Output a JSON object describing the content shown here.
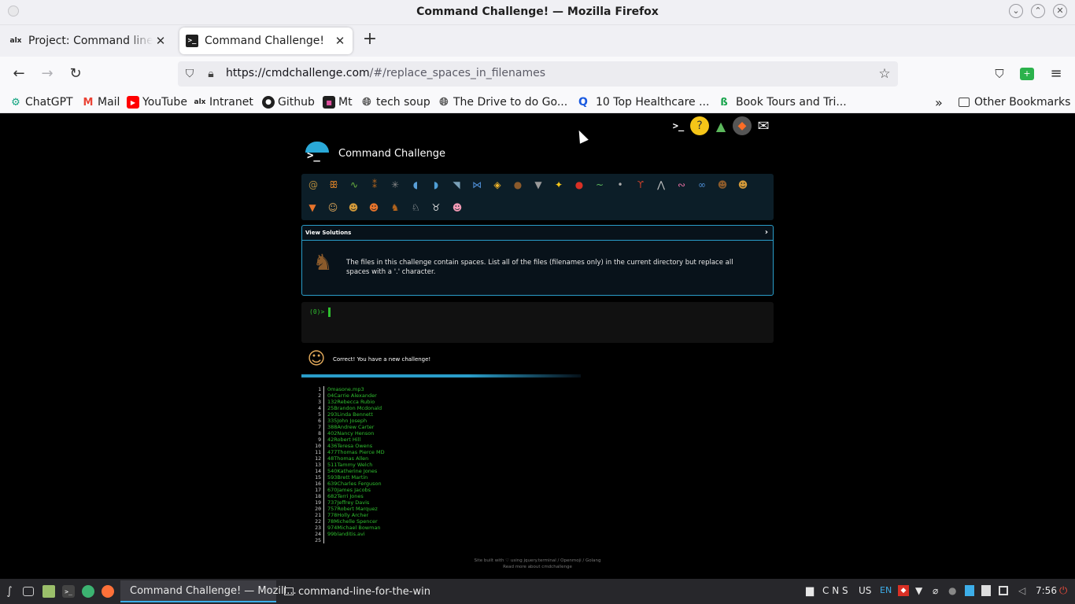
{
  "window": {
    "title": "Command Challenge! — Mozilla Firefox"
  },
  "tabs": [
    {
      "label": "Project: Command line fo",
      "favicon": "alx-icon",
      "active": false
    },
    {
      "label": "Command Challenge!",
      "favicon": "terminal-icon",
      "active": true
    }
  ],
  "nav": {
    "url_host": "https://cmdchallenge.com",
    "url_path": "/#/replace_spaces_in_filenames"
  },
  "bookmarks": [
    {
      "label": "ChatGPT",
      "icon": "chatgpt-icon",
      "color": "#10a37f"
    },
    {
      "label": "Mail",
      "icon": "gmail-icon",
      "color": "#ea4335"
    },
    {
      "label": "YouTube",
      "icon": "youtube-icon",
      "color": "#ff0000"
    },
    {
      "label": "Intranet",
      "icon": "alx-icon",
      "color": "#1f1f1f"
    },
    {
      "label": "Github",
      "icon": "github-icon",
      "color": "#1f1f1f"
    },
    {
      "label": "Mt",
      "icon": "mt-icon",
      "color": "#7b3fa0"
    },
    {
      "label": "tech soup",
      "icon": "globe-icon",
      "color": "#555555"
    },
    {
      "label": "The Drive to do Go...",
      "icon": "globe-icon",
      "color": "#555555"
    },
    {
      "label": "10 Top Healthcare ...",
      "icon": "healthcare-icon",
      "color": "#1a5ae0"
    },
    {
      "label": "Book Tours and Tri...",
      "icon": "tours-icon",
      "color": "#16a34a"
    }
  ],
  "other_bookmarks": "Other Bookmarks",
  "page": {
    "brand": "Command Challenge",
    "view_solutions": "View Solutions",
    "challenge_text": "The files in this challenge contain spaces. List all of the files (filenames only) in the current directory but replace all spaces with a '.' character.",
    "prompt": "(0)>",
    "result_message": "Correct! You have a new challenge!",
    "footer_line1": "Site built with ♡ using jquery.terminal / Openmoji / Golang",
    "footer_line2": "Read more about cmdchallenge"
  },
  "animals": [
    "snail",
    "butterfly",
    "caterpillar",
    "ant",
    "spider",
    "whale",
    "dolphin",
    "shark",
    "fish",
    "tropical-fish",
    "hedgehog",
    "wolf",
    "bee",
    "ladybug",
    "lizard",
    "mosquito",
    "scorpion",
    "fly",
    "worm",
    "link",
    "monkey",
    "dog",
    "fox",
    "lion",
    "tiger",
    "tiger-face",
    "horse",
    "unicorn",
    "cow",
    "pig"
  ],
  "output_files": [
    "0masone.mp3",
    "04Carrie Alexander",
    "132Rebecca Rubio",
    "25Brandon Mcdonald",
    "293Linda Bennett",
    "335John Joseph",
    "388Andrew Carter",
    "402Nancy Henson",
    "42Robert Hill",
    "436Teresa Owens",
    "477Thomas Pierce MD",
    "48Thomas Allen",
    "511Tammy Welch",
    "540Katherine Jones",
    "593Brett Martin",
    "639Charles Ferguson",
    "670James Jacobs",
    "682Terri Jones",
    "737Jeffrey Davis",
    "757Robert Marquez",
    "778Holly Archer",
    "78Michelle Spencer",
    "974Michael Bowman",
    "99blanditis.avi",
    ""
  ],
  "taskbar": {
    "windows": [
      {
        "label": "Command Challenge! — Mozill...",
        "active": true
      },
      {
        "label": "command-line-for-the-win",
        "active": false
      }
    ],
    "tray": {
      "keys": "C N S",
      "layout": "US",
      "lang": "EN",
      "clock": "7:56"
    }
  }
}
